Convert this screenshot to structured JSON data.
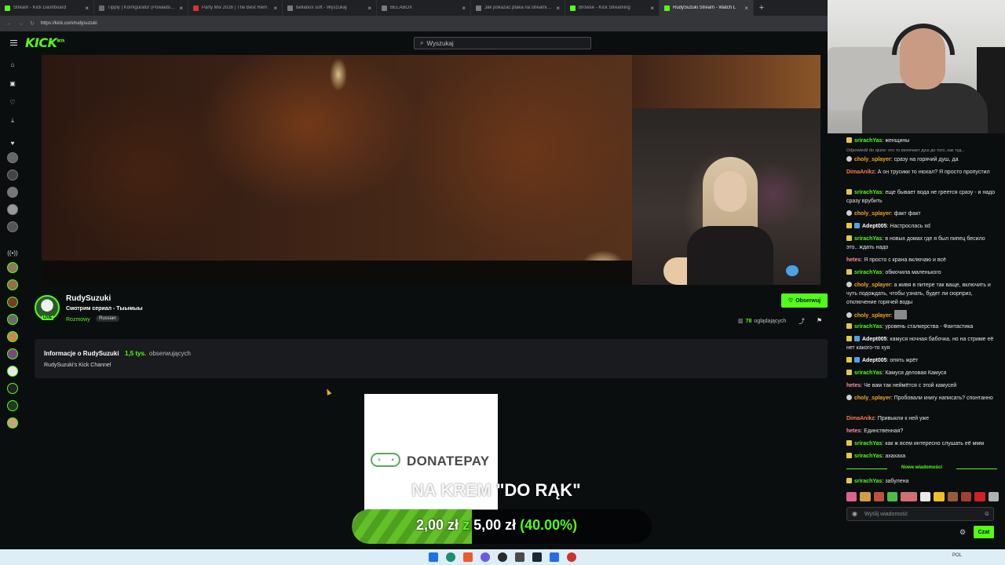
{
  "browser": {
    "tabs": [
      {
        "label": "Stream - Kick Dashboard",
        "color": "#53fc18"
      },
      {
        "label": "Tipply | Konfigurator (Powiadomie",
        "color": "#6b6b6b"
      },
      {
        "label": "Party Mix 2026 | The Best Rem",
        "color": "#e03030"
      },
      {
        "label": "bellabox soft - Wyszukaj",
        "color": "#7a7a7a"
      },
      {
        "label": "BELABOX",
        "color": "#7a7a7a"
      },
      {
        "label": "Jak pokazać ptaka na streamie - G",
        "color": "#7a7a7a"
      },
      {
        "label": "Browse - Kick Streaming",
        "color": "#53fc18"
      },
      {
        "label": "RudySuzuki Stream - Watch L",
        "color": "#53fc18"
      }
    ],
    "url": "https://kick.com/rudysuzuki"
  },
  "header": {
    "logo": "KICK",
    "logo_badge": "BETA",
    "search_placeholder": "Wyszukaj"
  },
  "channel": {
    "name": "RudySuzuki",
    "live_badge": "LIVE",
    "title": "Смотрим сериал - Тыымыы",
    "category": "Rozmowy",
    "tag": "Russian",
    "follow_label": "Obserwuj",
    "viewers_count": "78",
    "viewers_label": "oglądających"
  },
  "about": {
    "heading": "Informacje o RudySuzuki",
    "followers_count": "1,5 tys.",
    "followers_label": "obserwujących",
    "description": "RudySuzuki's Kick Channel"
  },
  "donation": {
    "brand": "DONATEPAY",
    "message_dim": "NA KREM",
    "message": "\"DO RĄK\"",
    "current": "2,00 zł",
    "separator": "z",
    "goal": "5,00 zł",
    "percent": "(40.00%)",
    "progress_fraction": 0.4
  },
  "chat": {
    "reply_hint": "Odpowiedź do qiune: кто то включает душ до того, как туд...",
    "messages": [
      {
        "user": "srirachYas",
        "text": "женщины",
        "color": "#53fc18"
      },
      {
        "user": "choly_splayer",
        "text": "сразу на горячий душ, да",
        "color": "#f5a623"
      },
      {
        "user": "DimaAnikz",
        "text": "А он трусики то нюхал? Я просто пропустил",
        "color": "#ff7b54"
      },
      {
        "user": "srirachYas",
        "text": "еще бывает вода не греется сразу - и надо сразу врубить",
        "color": "#53fc18"
      },
      {
        "user": "choly_splayer",
        "text": "факт факт",
        "color": "#f5a623"
      },
      {
        "user": "Adept005",
        "text": "Настрослась xd",
        "color": "#ffffff"
      },
      {
        "user": "srirachYas",
        "text": "в новых домах где я был пипец бесило это.. ждать надо",
        "color": "#53fc18"
      },
      {
        "user": "hetes",
        "text": "Я просто с крана включаю и всё",
        "color": "#ff8fa0"
      },
      {
        "user": "srirachYas",
        "text": "обмочила маленького",
        "color": "#53fc18"
      },
      {
        "user": "choly_splayer",
        "text": "а живя в питере так ваще, включить и чуть подождать, чтобы узнать, будет ли сюрприз, отключение горячей воды",
        "color": "#f5a623"
      },
      {
        "user": "choly_splayer",
        "text": "",
        "color": "#f5a623"
      },
      {
        "user": "srirachYas",
        "text": "уровень сталкерства - Фантастика",
        "color": "#53fc18"
      },
      {
        "user": "Adept005",
        "text": "камуся ночная бабочка, но на стриме её нет какого-то хуя",
        "color": "#ffffff"
      },
      {
        "user": "Adept005",
        "text": "опять жрёт",
        "color": "#ffffff"
      },
      {
        "user": "srirachYas",
        "text": "Камуся деловая Камуся",
        "color": "#53fc18"
      },
      {
        "user": "hetes",
        "text": "Че вам так неймётся с этой камусей",
        "color": "#ff8fa0"
      },
      {
        "user": "choly_splayer",
        "text": "Пробовали книгу написать? спонтанно",
        "color": "#f5a623"
      },
      {
        "user": "DimaAnikz",
        "text": "Привыкли к ней уже",
        "color": "#ff7b54"
      },
      {
        "user": "hetes",
        "text": "Единственная?",
        "color": "#ff8fa0"
      },
      {
        "user": "srirachYas",
        "text": "как ж всем интересно слушать её ммм",
        "color": "#53fc18"
      },
      {
        "user": "srirachYas",
        "text": "ахахаха",
        "color": "#53fc18"
      }
    ],
    "new_messages_label": "Nowe wiadomości",
    "last_message": {
      "user": "srirachYas",
      "text": "забулена",
      "color": "#53fc18"
    },
    "input_placeholder": "Wyślij wiadomość",
    "send_label": "Czat"
  },
  "taskbar": {
    "lang": "POL"
  }
}
